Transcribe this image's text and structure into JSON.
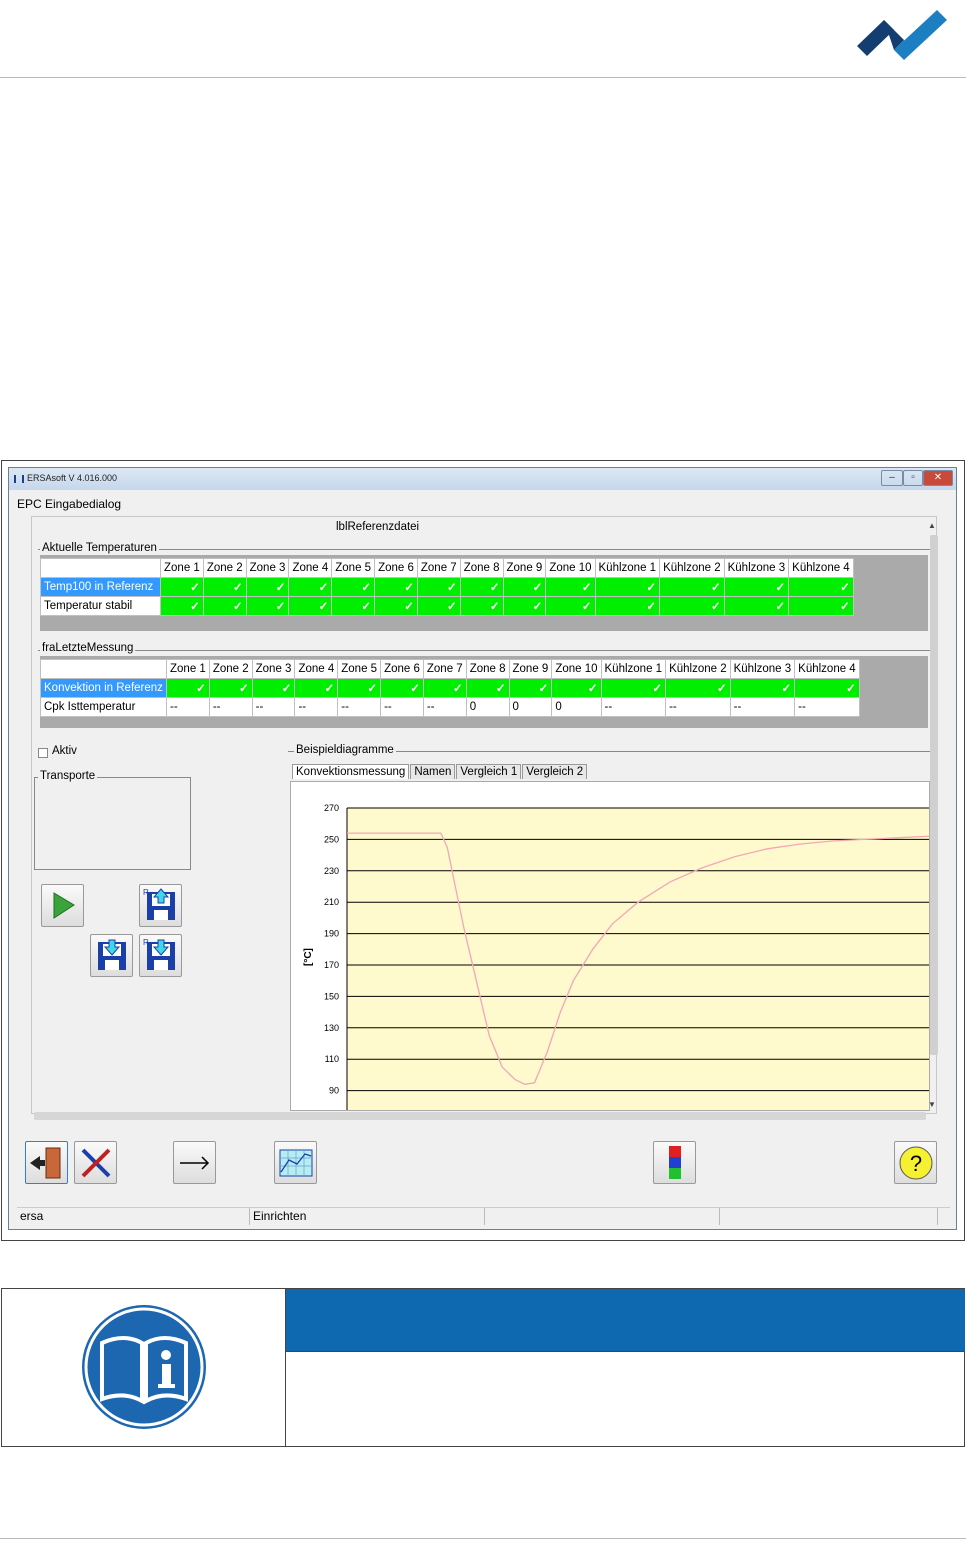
{
  "colors": {
    "brand_dark": "#143e71",
    "brand_light": "#1d7fc2",
    "ok_green": "#00ee00",
    "selection": "#3399ff",
    "note_band": "#0f69b0",
    "chart_bg": "#fffacd",
    "curve": "#f4a6b6"
  },
  "window": {
    "title": "ERSAsoft V 4.016.000",
    "menu": "EPC Eingabedialog",
    "file_label": "lblReferenzdatei"
  },
  "group1": {
    "title": "Aktuelle Temperaturen",
    "headers": [
      "Zone 1",
      "Zone 2",
      "Zone 3",
      "Zone 4",
      "Zone 5",
      "Zone 6",
      "Zone 7",
      "Zone 8",
      "Zone 9",
      "Zone 10",
      "Kühlzone 1",
      "Kühlzone 2",
      "Kühlzone 3",
      "Kühlzone 4"
    ],
    "rows": [
      {
        "label": "Temp100 in Referenz",
        "cells": [
          "✓",
          "✓",
          "✓",
          "✓",
          "✓",
          "✓",
          "✓",
          "✓",
          "✓",
          "✓",
          "✓",
          "✓",
          "✓",
          "✓"
        ]
      },
      {
        "label": "Temperatur stabil",
        "cells": [
          "✓",
          "✓",
          "✓",
          "✓",
          "✓",
          "✓",
          "✓",
          "✓",
          "✓",
          "✓",
          "✓",
          "✓",
          "✓",
          "✓"
        ]
      }
    ]
  },
  "group2": {
    "title": "fraLetzteMessung",
    "headers": [
      "Zone 1",
      "Zone 2",
      "Zone 3",
      "Zone 4",
      "Zone 5",
      "Zone 6",
      "Zone 7",
      "Zone 8",
      "Zone 9",
      "Zone 10",
      "Kühlzone 1",
      "Kühlzone 2",
      "Kühlzone 3",
      "Kühlzone 4"
    ],
    "rows": [
      {
        "label": "Konvektion in Referenz",
        "cells": [
          "✓",
          "✓",
          "✓",
          "✓",
          "✓",
          "✓",
          "✓",
          "✓",
          "✓",
          "✓",
          "✓",
          "✓",
          "✓",
          "✓"
        ]
      },
      {
        "label": "Cpk Isttemperatur",
        "cells": [
          "--",
          "--",
          "--",
          "--",
          "--",
          "--",
          "--",
          "0",
          "0",
          "0",
          "--",
          "--",
          "--",
          "--"
        ]
      }
    ]
  },
  "aktiv_label": "Aktiv",
  "transporte_label": "Transporte",
  "diagram": {
    "title": "Beispieldiagramme",
    "tabs": [
      "Konvektionsmessung",
      "Namen",
      "Vergleich 1",
      "Vergleich 2"
    ]
  },
  "chart_data": {
    "type": "line",
    "ylabel": "[°C]",
    "ylim": [
      80,
      270
    ],
    "yticks": [
      270,
      250,
      230,
      210,
      190,
      170,
      150,
      130,
      110,
      90
    ],
    "x": [
      0,
      10,
      20,
      29,
      31,
      33,
      36,
      40,
      44,
      48,
      52,
      55,
      58,
      62,
      66,
      70,
      76,
      82,
      90,
      100,
      110,
      120,
      130,
      140,
      150,
      160,
      170,
      180
    ],
    "series": [
      {
        "values": [
          254,
          254,
          254,
          254,
          245,
          225,
          195,
          160,
          125,
          105,
          97,
          94,
          95,
          115,
          140,
          160,
          180,
          196,
          210,
          223,
          232,
          239,
          244,
          247,
          249,
          250,
          251,
          252
        ]
      }
    ],
    "grid": "horizontal"
  },
  "status": {
    "user": "ersa",
    "mode": "Einrichten",
    "cell3": "",
    "cell4": ""
  },
  "icons": {
    "exit": "exit-door-icon",
    "tools": "tools-icon",
    "arrow": "right-arrow-icon",
    "chart": "chart-icon",
    "colors": "color-bars-icon",
    "help": "help-icon",
    "play": "play-icon",
    "save_ref_up": "save-reference-upload-icon",
    "save_down": "save-download-icon",
    "save_ref_down": "save-reference-download-icon",
    "info": "manual-info-icon"
  }
}
